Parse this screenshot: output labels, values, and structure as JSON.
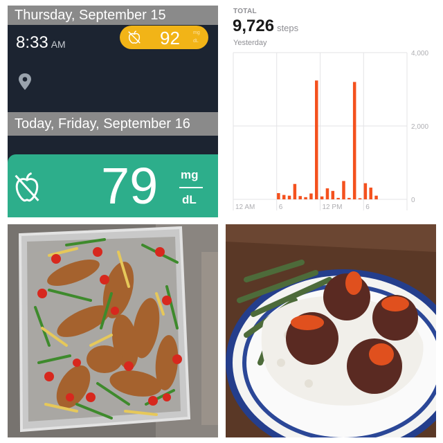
{
  "log": {
    "day1": "Thursday, September 15",
    "time": "8:33",
    "ampm": "AM",
    "reading1": "92",
    "reading1_unit_top": "mg",
    "reading1_unit_bottom": "dL",
    "day2": "Today, Friday, September 16",
    "reading2": "79",
    "reading2_unit_top": "mg",
    "reading2_unit_bottom": "dL",
    "icons": [
      "apple-icon",
      "location-pin-icon"
    ],
    "colors": {
      "panel_bg": "#1c2431",
      "header_bg": "#8a8a8a",
      "pill": "#f2b417",
      "green": "#2dae8b"
    }
  },
  "steps": {
    "label": "TOTAL",
    "value": "9,726",
    "unit": "steps",
    "period": "Yesterday"
  },
  "chart_data": {
    "type": "bar",
    "title": "",
    "xlabel": "",
    "ylabel": "",
    "x_ticks": [
      "12 AM",
      "6",
      "12 PM",
      "6"
    ],
    "y_ticks": [
      "4,000",
      "2,000",
      "0"
    ],
    "ylim": [
      0,
      4000
    ],
    "x_range_hours": [
      0,
      24
    ],
    "grid": true,
    "bar_color": "#f4511e",
    "bars": [
      {
        "hour": 6.25,
        "value": 170
      },
      {
        "hour": 7.0,
        "value": 120
      },
      {
        "hour": 7.75,
        "value": 100
      },
      {
        "hour": 8.5,
        "value": 420
      },
      {
        "hour": 9.25,
        "value": 90
      },
      {
        "hour": 10.0,
        "value": 60
      },
      {
        "hour": 10.75,
        "value": 160
      },
      {
        "hour": 11.5,
        "value": 3240
      },
      {
        "hour": 12.25,
        "value": 80
      },
      {
        "hour": 13.0,
        "value": 300
      },
      {
        "hour": 13.75,
        "value": 230
      },
      {
        "hour": 14.5,
        "value": 40
      },
      {
        "hour": 15.25,
        "value": 500
      },
      {
        "hour": 16.0,
        "value": 40
      },
      {
        "hour": 16.75,
        "value": 3200
      },
      {
        "hour": 17.5,
        "value": 30
      },
      {
        "hour": 18.25,
        "value": 440
      },
      {
        "hour": 19.0,
        "value": 320
      },
      {
        "hour": 19.75,
        "value": 100
      }
    ]
  }
}
